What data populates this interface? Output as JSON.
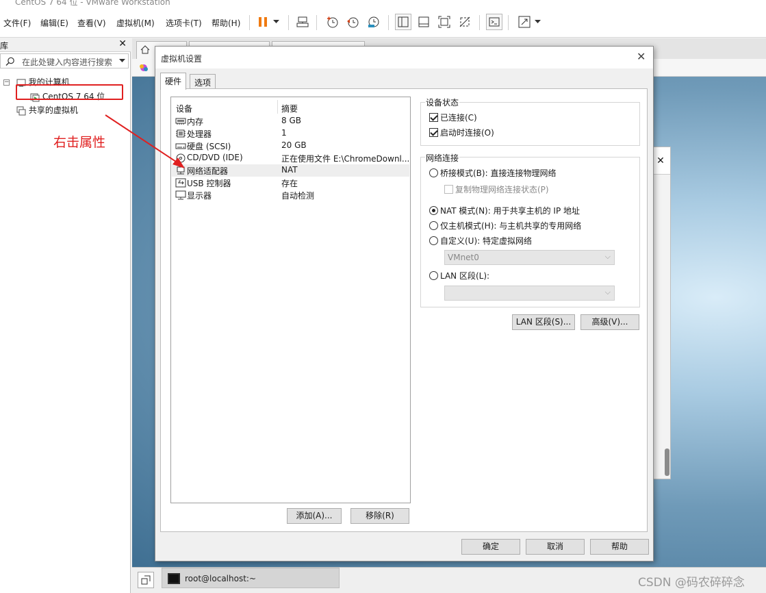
{
  "window": {
    "title": "CentOS 7 64 位 - VMware Workstation"
  },
  "menu": {
    "file": "文件(F)",
    "edit": "编辑(E)",
    "view": "查看(V)",
    "vm": "虚拟机(M)",
    "tabs": "选项卡(T)",
    "help": "帮助(H)"
  },
  "toolbar_icons": [
    "pause-icon",
    "dropdown-icon",
    "send-keys-icon",
    "snapshot-icon",
    "revert-snapshot-icon",
    "snapshot-manager-icon",
    "library-view-icon",
    "thumbnail-view-icon",
    "fullscreen-icon",
    "unity-icon",
    "console-icon",
    "stretch-icon"
  ],
  "library": {
    "title": "库",
    "search_placeholder": "在此处键入内容进行搜索",
    "my_computer": "我的计算机",
    "vm_name": "CentOS 7 64 位",
    "shared": "共享的虚拟机"
  },
  "annotation": {
    "text": "右击属性",
    "color": "#e02020"
  },
  "statusbar": {
    "terminal": "root@localhost:~"
  },
  "watermark": "CSDN @码农碎碎念",
  "dialog": {
    "title": "虚拟机设置",
    "tab_hardware": "硬件",
    "tab_options": "选项",
    "col_device": "设备",
    "col_summary": "摘要",
    "devices": [
      {
        "name": "内存",
        "summary": "8 GB",
        "icon": "memory-icon"
      },
      {
        "name": "处理器",
        "summary": "1",
        "icon": "cpu-icon"
      },
      {
        "name": "硬盘 (SCSI)",
        "summary": "20 GB",
        "icon": "disk-icon"
      },
      {
        "name": "CD/DVD (IDE)",
        "summary": "正在使用文件 E:\\ChromeDownl...",
        "icon": "cd-icon"
      },
      {
        "name": "网络适配器",
        "summary": "NAT",
        "icon": "network-icon"
      },
      {
        "name": "USB 控制器",
        "summary": "存在",
        "icon": "usb-icon"
      },
      {
        "name": "显示器",
        "summary": "自动检测",
        "icon": "monitor-icon"
      }
    ],
    "add_button": "添加(A)...",
    "remove_button": "移除(R)",
    "device_status": {
      "title": "设备状态",
      "connected": "已连接(C)",
      "connect_on_power_on": "启动时连接(O)"
    },
    "network": {
      "title": "网络连接",
      "bridged": "桥接模式(B): 直接连接物理网络",
      "replicate": "复制物理网络连接状态(P)",
      "nat": "NAT 模式(N): 用于共享主机的 IP 地址",
      "host_only": "仅主机模式(H): 与主机共享的专用网络",
      "custom": "自定义(U): 特定虚拟网络",
      "custom_value": "VMnet0",
      "lan": "LAN 区段(L):",
      "lan_value": ""
    },
    "lan_segments_button": "LAN 区段(S)...",
    "advanced_button": "高级(V)...",
    "ok_button": "确定",
    "cancel_button": "取消",
    "help_button": "帮助"
  }
}
